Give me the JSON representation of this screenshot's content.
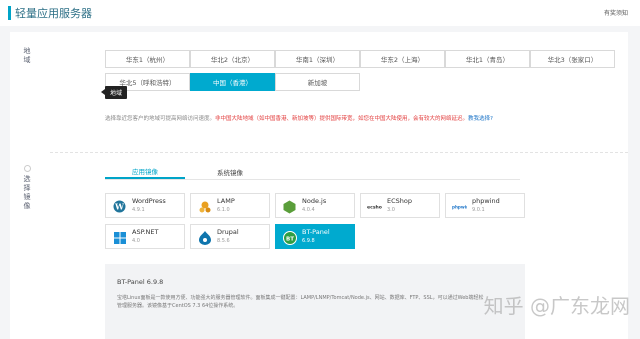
{
  "header": {
    "title": "轻量应用服务器",
    "notice": "有奖须知"
  },
  "sections": {
    "region_label": "地域",
    "image_label": "选择镜像"
  },
  "regions": [
    {
      "label": "华东1（杭州）",
      "selected": false
    },
    {
      "label": "华北2（北京）",
      "selected": false
    },
    {
      "label": "华南1（深圳）",
      "selected": false
    },
    {
      "label": "华东2（上海）",
      "selected": false
    },
    {
      "label": "华北1（青岛）",
      "selected": false
    },
    {
      "label": "华北3（张家口）",
      "selected": false
    },
    {
      "label": "华北5（呼和浩特）",
      "selected": false
    },
    {
      "label": "中国（香港）",
      "selected": true
    },
    {
      "label": "新加坡",
      "selected": false
    }
  ],
  "tooltip": "地域",
  "hint": {
    "part1": "选择靠近您客户的地域可提高网络访问速度。",
    "part2": "非中国大陆地域（如中国香港、新加坡等）提供国际带宽，如您在中国大陆使用，会有较大的网络延迟。",
    "link": "教我选择?"
  },
  "tabs": [
    {
      "label": "应用镜像",
      "active": true
    },
    {
      "label": "系统镜像",
      "active": false
    }
  ],
  "apps": [
    {
      "name": "WordPress",
      "version": "4.9.1",
      "icon": "wordpress-icon",
      "selected": false
    },
    {
      "name": "LAMP",
      "version": "6.1.0",
      "icon": "lamp-icon",
      "selected": false
    },
    {
      "name": "Node.js",
      "version": "4.0.4",
      "icon": "nodejs-icon",
      "selected": false
    },
    {
      "name": "ECShop",
      "version": "3.0",
      "icon": "ecshop-icon",
      "selected": false
    },
    {
      "name": "phpwind",
      "version": "9.0.1",
      "icon": "phpwind-icon",
      "selected": false
    },
    {
      "name": "ASP.NET",
      "version": "4.0",
      "icon": "aspnet-icon",
      "selected": false
    },
    {
      "name": "Drupal",
      "version": "8.5.6",
      "icon": "drupal-icon",
      "selected": false
    },
    {
      "name": "BT-Panel",
      "version": "6.9.8",
      "icon": "btpanel-icon",
      "selected": true
    }
  ],
  "description": {
    "title": "BT-Panel 6.9.8",
    "text": "宝塔Linux面板是一款使用方便、功能强大的服务器管理软件。面板集成一键配置：LAMP/LNMP/Tomcat/Node.js、网站、数据库、FTP、SSL，可以通过Web端轻松管理服务器。该镜像基于CentOS 7.3 64位操作系统。"
  },
  "watermark": "知乎 @广东龙网"
}
